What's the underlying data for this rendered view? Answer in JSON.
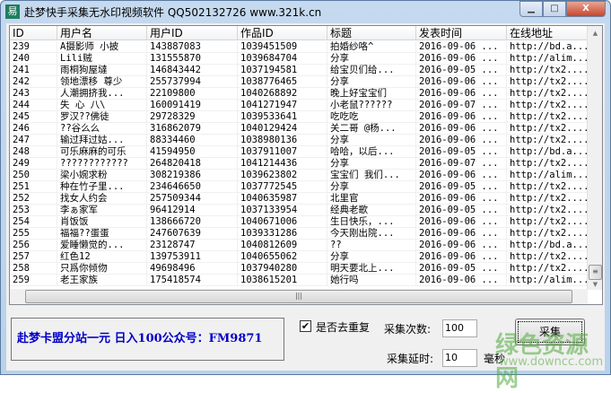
{
  "window": {
    "title": "赴梦快手采集无水印视频软件  QQ502132726  www.321k.cn",
    "icon": "app-icon",
    "buttons": [
      "minimize",
      "maximize",
      "close"
    ]
  },
  "table": {
    "columns": [
      "ID",
      "用户名",
      "用户ID",
      "作品ID",
      "标题",
      "发表时间",
      "在线地址"
    ],
    "rows": [
      [
        "239",
        "A摄影师  小披",
        "143887083",
        "1039451509",
        "拍婚纱咯^",
        "2016-09-06 ...",
        "http://bd.a..."
      ],
      [
        "240",
        "Lili贼",
        "131555870",
        "1039684704",
        "分享",
        "2016-09-06 ...",
        "http://alim..."
      ],
      [
        "241",
        "雨桐狗屋墶",
        "146843442",
        "1037194581",
        "给宝贝们给...",
        "2016-09-05 ...",
        "http://tx2...."
      ],
      [
        "242",
        "领地漂移  尊少",
        "255737994",
        "1038776465",
        "分享",
        "2016-09-06 ...",
        "http://tx2...."
      ],
      [
        "243",
        "人潮拥挤我...",
        "22109800",
        "1040268892",
        "晚上好宝宝们",
        "2016-09-06 ...",
        "http://tx2...."
      ],
      [
        "244",
        "失 心   八\\",
        "160091419",
        "1041271947",
        "小老鼠??????",
        "2016-09-07 ...",
        "http://tx2...."
      ],
      [
        "245",
        "罗汉??佛徒",
        "29728329",
        "1039533641",
        "吃吃吃",
        "2016-09-06 ...",
        "http://tx2...."
      ],
      [
        "246",
        "??谷么么",
        "316862079",
        "1040129424",
        "关二哥 @杨...",
        "2016-09-06 ...",
        "http://tx2...."
      ],
      [
        "247",
        "输过拜过姑...",
        "88334460",
        "1038980136",
        "分享",
        "2016-09-06 ...",
        "http://tx2...."
      ],
      [
        "248",
        "可乐麻麻的可乐",
        "41594950",
        "1037911007",
        "哈哈，以后...",
        "2016-09-05 ...",
        "http://bd.a..."
      ],
      [
        "249",
        "????????????",
        "264820418",
        "1041214436",
        "分享",
        "2016-09-07 ...",
        "http://tx2...."
      ],
      [
        "250",
        "梁小婉求粉",
        "308219386",
        "1039623802",
        "宝宝们 我们...",
        "2016-09-06 ...",
        "http://alim..."
      ],
      [
        "251",
        "种在竹子里...",
        "234646650",
        "1037772545",
        "分享",
        "2016-09-05 ...",
        "http://tx2...."
      ],
      [
        "252",
        "找女人约会",
        "257509344",
        "1040635987",
        "北里官",
        "2016-09-06 ...",
        "http://tx2...."
      ],
      [
        "253",
        "李ぁ家军",
        "96412914",
        "1037133954",
        "经典老歌",
        "2016-09-05 ...",
        "http://tx2...."
      ],
      [
        "254",
        "肖饭饭",
        "138666720",
        "1040671006",
        "生日快乐，...",
        "2016-09-06 ...",
        "http://tx2...."
      ],
      [
        "255",
        "福福??蛋蛋",
        "247607639",
        "1039331286",
        "今天刚出院...",
        "2016-09-06 ...",
        "http://tx2...."
      ],
      [
        "256",
        "爱睡懒觉的...",
        "23128747",
        "1040812609",
        "??",
        "2016-09-06 ...",
        "http://bd.a..."
      ],
      [
        "257",
        "红色12",
        "139753911",
        "1040655062",
        "分享",
        "2016-09-06 ...",
        "http://tx2...."
      ],
      [
        "258",
        "只爲你倾伆",
        "49698496",
        "1037940280",
        "明天要北上...",
        "2016-09-05 ...",
        "http://tx2...."
      ],
      [
        "259",
        "老王家族",
        "175418574",
        "1038615201",
        "她行吗",
        "2016-09-06 ...",
        "http://alim..."
      ]
    ]
  },
  "promo": {
    "text": "赴梦卡盟分站一元 日入100公众号：FM9871",
    "color": "#0000c8"
  },
  "controls": {
    "dedupe_label": "是否去重复",
    "dedupe_checked": true,
    "count_label": "采集次数:",
    "count_value": "100",
    "delay_label": "采集延时:",
    "delay_value": "10",
    "delay_unit": "毫秒",
    "collect_button": "采集"
  },
  "watermark": {
    "text": "绿色资源网",
    "url": "www.downcc.com"
  }
}
